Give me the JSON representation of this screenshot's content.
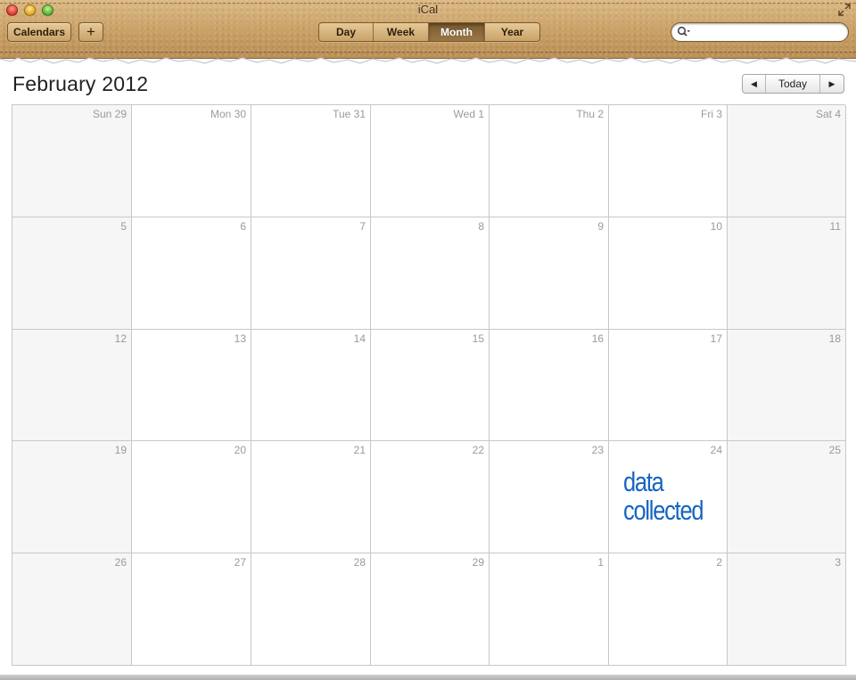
{
  "window": {
    "title": "iCal"
  },
  "toolbar": {
    "calendars_label": "Calendars",
    "add_label": "+",
    "views": [
      {
        "label": "Day",
        "selected": false
      },
      {
        "label": "Week",
        "selected": false
      },
      {
        "label": "Month",
        "selected": true
      },
      {
        "label": "Year",
        "selected": false
      }
    ],
    "search": {
      "value": "",
      "placeholder": ""
    }
  },
  "header": {
    "month_title": "February 2012",
    "prev_icon": "◀",
    "today_label": "Today",
    "next_icon": "▶"
  },
  "calendar": {
    "weeks": [
      [
        "Sun 29",
        "Mon 30",
        "Tue 31",
        "Wed 1",
        "Thu 2",
        "Fri 3",
        "Sat 4"
      ],
      [
        "5",
        "6",
        "7",
        "8",
        "9",
        "10",
        "11"
      ],
      [
        "12",
        "13",
        "14",
        "15",
        "16",
        "17",
        "18"
      ],
      [
        "19",
        "20",
        "21",
        "22",
        "23",
        "24",
        "25"
      ],
      [
        "26",
        "27",
        "28",
        "29",
        "1",
        "2",
        "3"
      ]
    ],
    "annotation": {
      "day": "24",
      "text": "data collected",
      "color": "#1565c0"
    }
  }
}
